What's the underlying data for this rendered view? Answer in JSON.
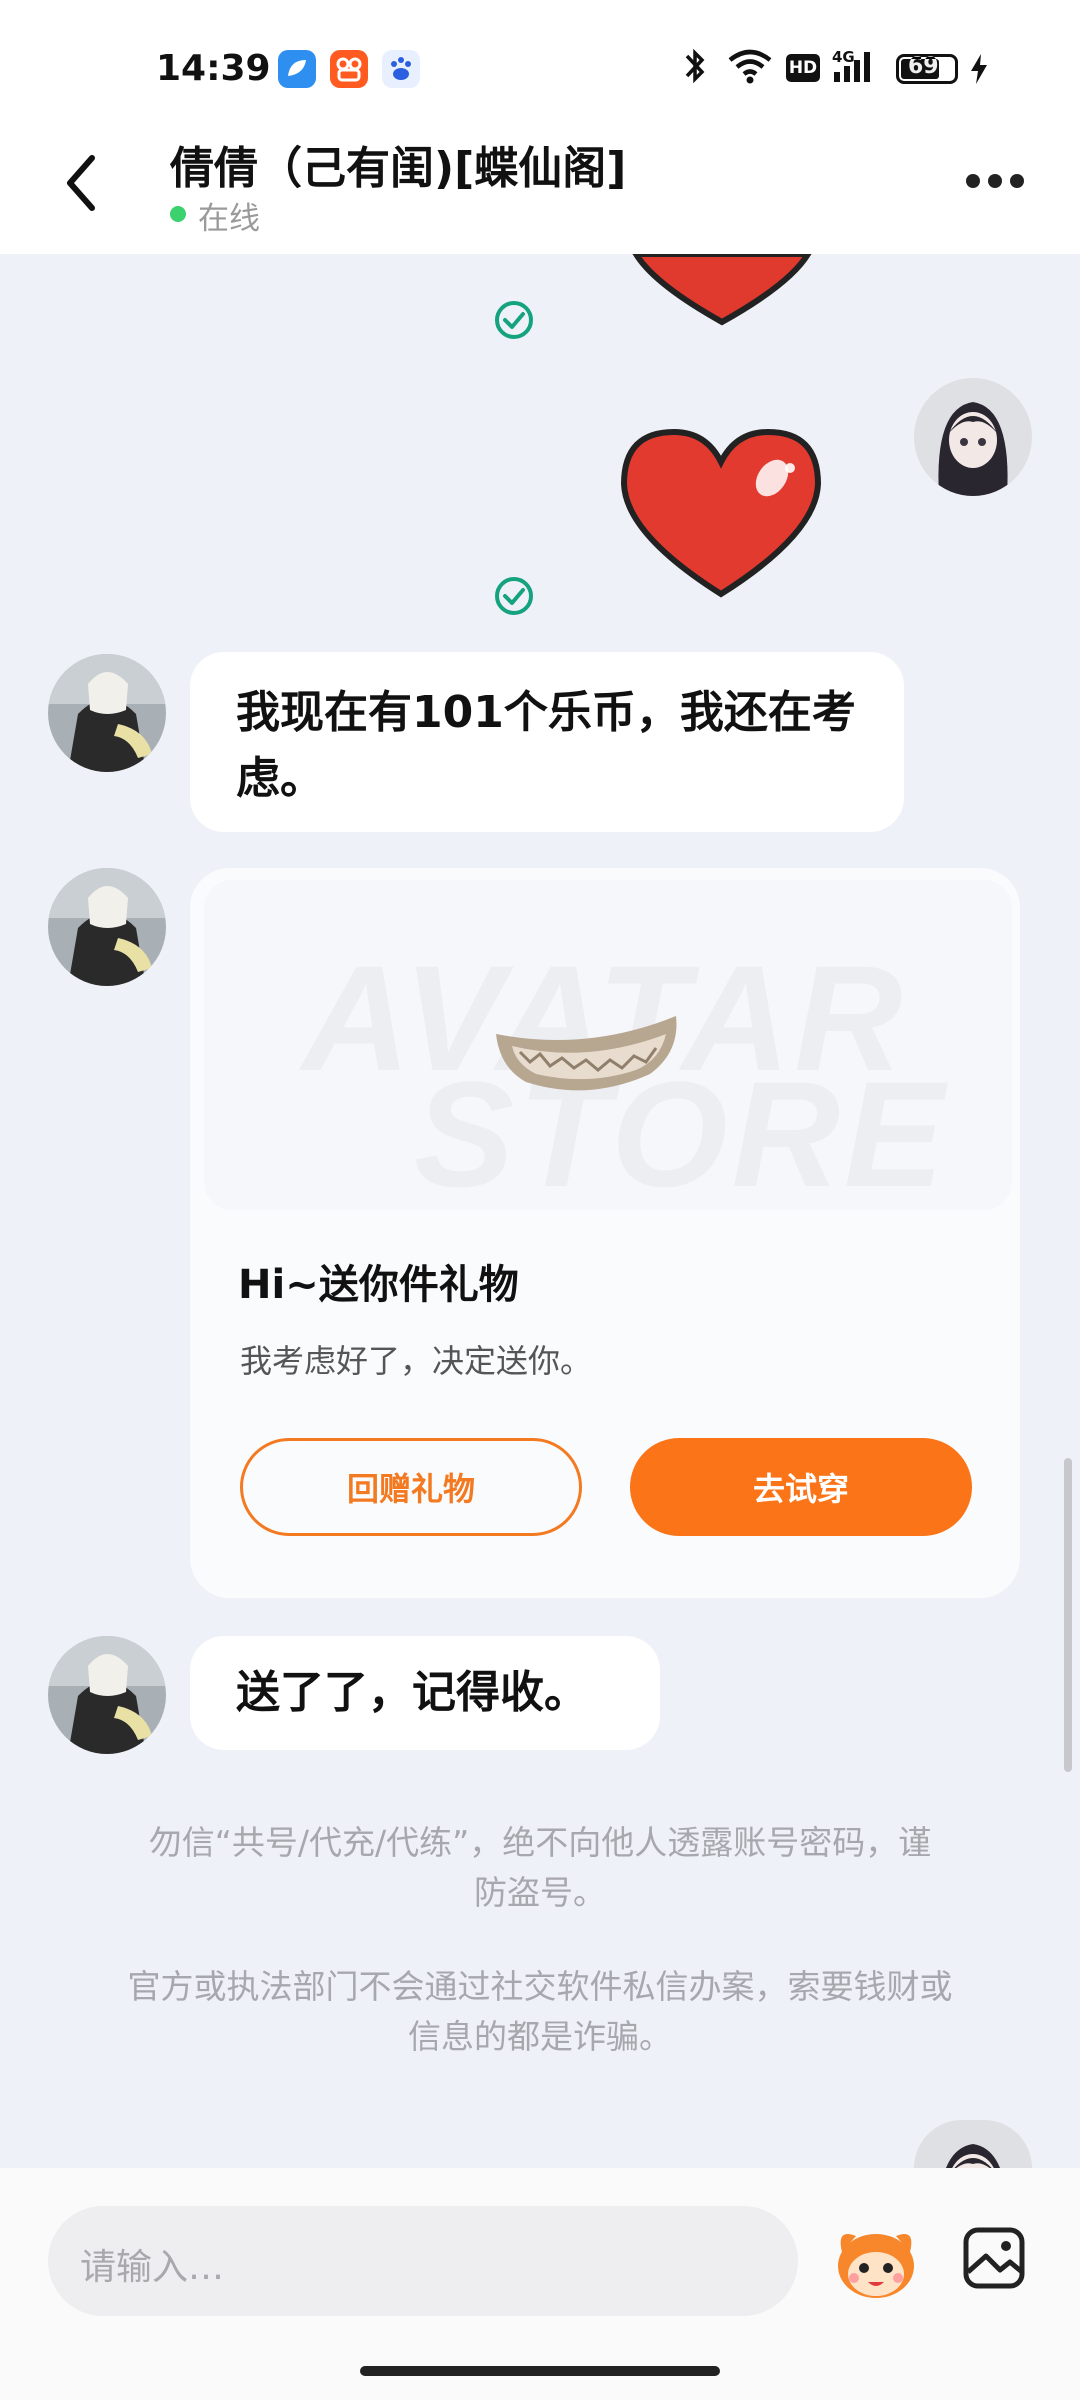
{
  "status_bar": {
    "time": "14:39",
    "battery": "69",
    "network": "4G",
    "hd": "HD"
  },
  "header": {
    "title": "倩倩（己有闺)[蝶仙阁]",
    "status": "在线"
  },
  "messages": {
    "msg1": "我现在有101个乐币，我还在考虑。",
    "msg3": "送了了，记得收。"
  },
  "gift_card": {
    "watermark_line1": "AVATAR",
    "watermark_line2": "STORE",
    "title": "Hi~送你件礼物",
    "description": "我考虑好了，决定送你。",
    "return_gift_label": "回赠礼物",
    "try_on_label": "去试穿"
  },
  "notices": {
    "notice1_line1": "勿信“共号/代充/代练”，绝不向他人透露账号密码，谨",
    "notice1_line2": "防盗号。",
    "notice2_line1": "官方或执法部门不会通过社交软件私信办案，索要钱财或",
    "notice2_line2": "信息的都是诈骗。"
  },
  "input": {
    "placeholder": "请输入…"
  },
  "colors": {
    "accent": "#fb7417",
    "online": "#3bd16f",
    "check": "#15a37f",
    "background": "#eff1f8"
  },
  "icons": [
    "back-icon",
    "more-icon",
    "check-icon",
    "emoji-mascot-icon",
    "image-icon",
    "bluetooth-icon",
    "wifi-icon",
    "signal-icon",
    "battery-icon"
  ]
}
